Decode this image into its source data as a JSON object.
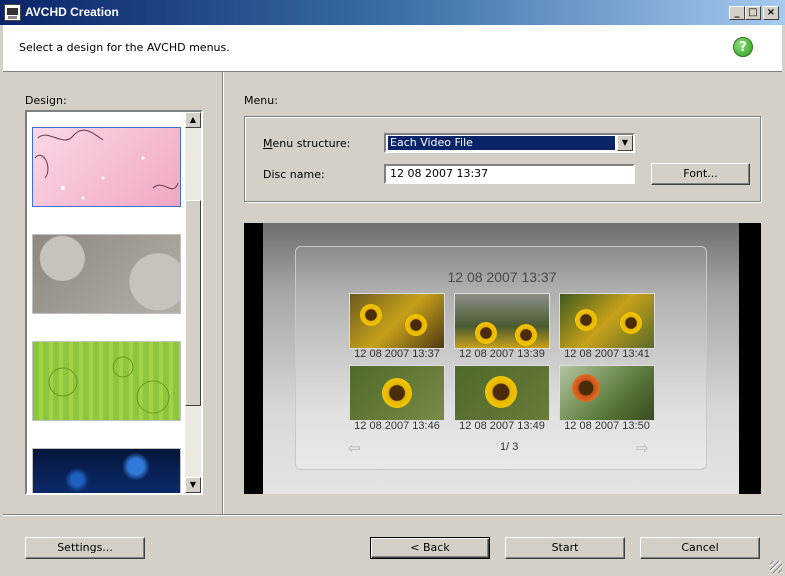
{
  "window": {
    "title": "AVCHD Creation",
    "controls": [
      "_",
      "□",
      "×"
    ]
  },
  "header": {
    "instruction": "Select a design for the AVCHD menus.",
    "help_icon": "help-icon"
  },
  "design": {
    "label": "Design:",
    "themes": [
      {
        "name": "pink-floral",
        "colors": [
          "#f6c6d8",
          "#f3a9c1"
        ]
      },
      {
        "name": "gray-bokeh",
        "colors": [
          "#9e9a92",
          "#c8c3ba"
        ]
      },
      {
        "name": "green-swirl",
        "colors": [
          "#8cc63f",
          "#b6dd4a"
        ]
      },
      {
        "name": "blue-lights",
        "colors": [
          "#0a1e4d",
          "#1b5fb5"
        ]
      }
    ]
  },
  "menu": {
    "label": "Menu:",
    "structure_label": "Menu structure:",
    "structure_value": "Each Video File",
    "disc_name_label": "Disc name:",
    "disc_name_value": "12 08 2007  13:37",
    "font_button": "Font..."
  },
  "preview": {
    "title": "12 08 2007  13:37",
    "thumbnails": [
      {
        "caption": "12 08 2007  13:37"
      },
      {
        "caption": "12 08 2007  13:39"
      },
      {
        "caption": "12 08 2007  13:41"
      },
      {
        "caption": "12 08 2007  13:46"
      },
      {
        "caption": "12 08 2007  13:49"
      },
      {
        "caption": "12 08 2007  13:50"
      }
    ],
    "pager": "1/   3"
  },
  "footer": {
    "settings_button": "Settings...",
    "back_button": "< Back",
    "start_button": "Start",
    "cancel_button": "Cancel"
  }
}
